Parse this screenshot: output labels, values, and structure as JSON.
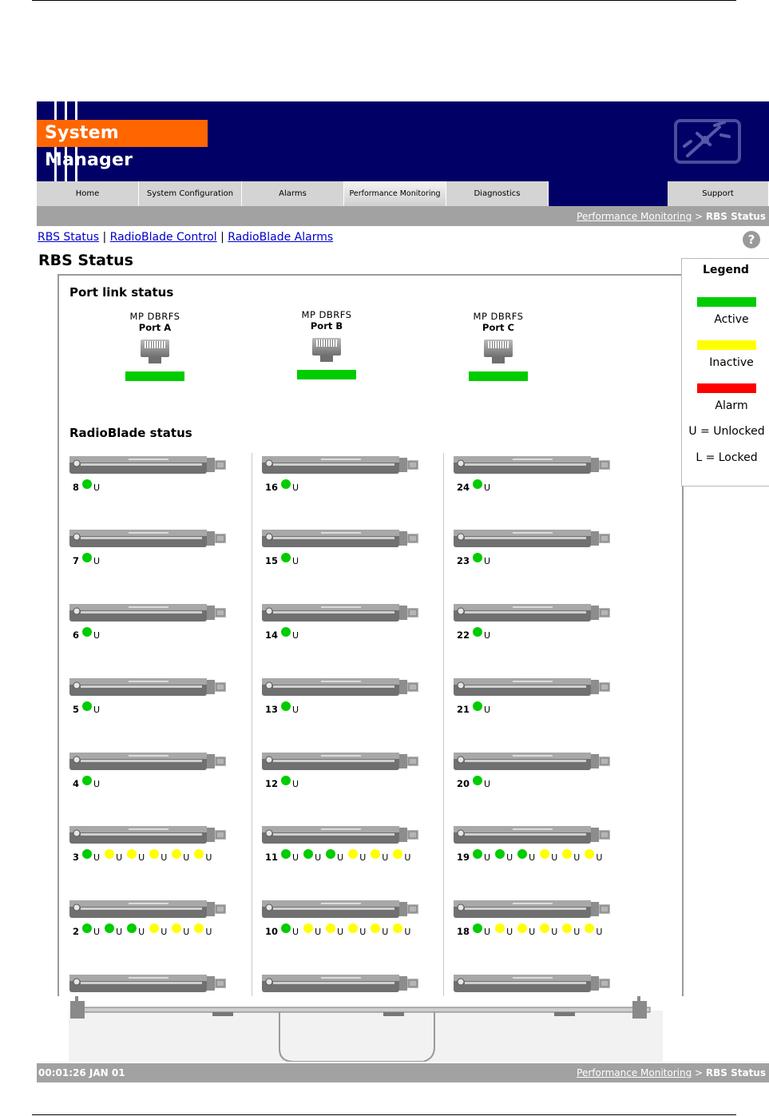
{
  "app": {
    "logo_text": "System Manager",
    "accent": "#ff6600",
    "header_bg": "#000066"
  },
  "nav": {
    "tabs": [
      {
        "label": "Home"
      },
      {
        "label": "System Configuration"
      },
      {
        "label": "Alarms"
      },
      {
        "label": "Performance Monitoring",
        "active": true
      },
      {
        "label": "Diagnostics"
      },
      {
        "label": "Support"
      }
    ]
  },
  "breadcrumb": {
    "link": "Performance Monitoring",
    "sep": " > ",
    "current": "RBS Status"
  },
  "subnav": {
    "links": [
      "RBS Status",
      "RadioBlade Control",
      "RadioBlade Alarms"
    ],
    "sep": " | "
  },
  "help_icon": "?",
  "page_title": "RBS Status",
  "port_section_title": "Port link status",
  "ports": [
    {
      "type": "MP DBRFS",
      "name": "Port A",
      "status": "active"
    },
    {
      "type": "MP DBRFS",
      "name": "Port B",
      "status": "active"
    },
    {
      "type": "MP DBRFS",
      "name": "Port C",
      "status": "active"
    }
  ],
  "radioblade_section_title": "RadioBlade status",
  "blades": [
    [
      {
        "num": "8",
        "leds": [
          {
            "c": "g",
            "s": "U"
          }
        ]
      },
      {
        "num": "7",
        "leds": [
          {
            "c": "g",
            "s": "U"
          }
        ]
      },
      {
        "num": "6",
        "leds": [
          {
            "c": "g",
            "s": "U"
          }
        ]
      },
      {
        "num": "5",
        "leds": [
          {
            "c": "g",
            "s": "U"
          }
        ]
      },
      {
        "num": "4",
        "leds": [
          {
            "c": "g",
            "s": "U"
          }
        ]
      },
      {
        "num": "3",
        "leds": [
          {
            "c": "g",
            "s": "U"
          },
          {
            "c": "y",
            "s": "U"
          },
          {
            "c": "y",
            "s": "U"
          },
          {
            "c": "y",
            "s": "U"
          },
          {
            "c": "y",
            "s": "U"
          },
          {
            "c": "y",
            "s": "U"
          }
        ]
      },
      {
        "num": "2",
        "leds": [
          {
            "c": "g",
            "s": "U"
          },
          {
            "c": "g",
            "s": "U"
          },
          {
            "c": "g",
            "s": "U"
          },
          {
            "c": "y",
            "s": "U"
          },
          {
            "c": "y",
            "s": "U"
          },
          {
            "c": "y",
            "s": "U"
          }
        ]
      },
      {
        "num": "",
        "leds": []
      }
    ],
    [
      {
        "num": "16",
        "leds": [
          {
            "c": "g",
            "s": "U"
          }
        ]
      },
      {
        "num": "15",
        "leds": [
          {
            "c": "g",
            "s": "U"
          }
        ]
      },
      {
        "num": "14",
        "leds": [
          {
            "c": "g",
            "s": "U"
          }
        ]
      },
      {
        "num": "13",
        "leds": [
          {
            "c": "g",
            "s": "U"
          }
        ]
      },
      {
        "num": "12",
        "leds": [
          {
            "c": "g",
            "s": "U"
          }
        ]
      },
      {
        "num": "11",
        "leds": [
          {
            "c": "g",
            "s": "U"
          },
          {
            "c": "g",
            "s": "U"
          },
          {
            "c": "g",
            "s": "U"
          },
          {
            "c": "y",
            "s": "U"
          },
          {
            "c": "y",
            "s": "U"
          },
          {
            "c": "y",
            "s": "U"
          }
        ]
      },
      {
        "num": "10",
        "leds": [
          {
            "c": "g",
            "s": "U"
          },
          {
            "c": "y",
            "s": "U"
          },
          {
            "c": "y",
            "s": "U"
          },
          {
            "c": "y",
            "s": "U"
          },
          {
            "c": "y",
            "s": "U"
          },
          {
            "c": "y",
            "s": "U"
          }
        ]
      },
      {
        "num": "",
        "leds": []
      }
    ],
    [
      {
        "num": "24",
        "leds": [
          {
            "c": "g",
            "s": "U"
          }
        ]
      },
      {
        "num": "23",
        "leds": [
          {
            "c": "g",
            "s": "U"
          }
        ]
      },
      {
        "num": "22",
        "leds": [
          {
            "c": "g",
            "s": "U"
          }
        ]
      },
      {
        "num": "21",
        "leds": [
          {
            "c": "g",
            "s": "U"
          }
        ]
      },
      {
        "num": "20",
        "leds": [
          {
            "c": "g",
            "s": "U"
          }
        ]
      },
      {
        "num": "19",
        "leds": [
          {
            "c": "g",
            "s": "U"
          },
          {
            "c": "g",
            "s": "U"
          },
          {
            "c": "g",
            "s": "U"
          },
          {
            "c": "y",
            "s": "U"
          },
          {
            "c": "y",
            "s": "U"
          },
          {
            "c": "y",
            "s": "U"
          }
        ]
      },
      {
        "num": "18",
        "leds": [
          {
            "c": "g",
            "s": "U"
          },
          {
            "c": "y",
            "s": "U"
          },
          {
            "c": "y",
            "s": "U"
          },
          {
            "c": "y",
            "s": "U"
          },
          {
            "c": "y",
            "s": "U"
          },
          {
            "c": "y",
            "s": "U"
          }
        ]
      },
      {
        "num": "",
        "leds": []
      }
    ]
  ],
  "legend": {
    "title": "Legend",
    "items": [
      {
        "label": "Active",
        "color": "#00cc00"
      },
      {
        "label": "Inactive",
        "color": "#ffff00"
      },
      {
        "label": "Alarm",
        "color": "#ff0000"
      }
    ],
    "unlocked": "U = Unlocked",
    "locked": "L = Locked"
  },
  "status_bar": {
    "time": "00:01:26 JAN 01"
  }
}
